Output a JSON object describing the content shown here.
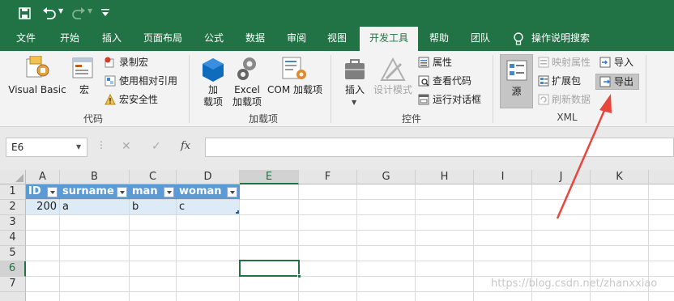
{
  "qat": {
    "save_icon": "save-icon",
    "undo_icon": "undo-icon",
    "redo_icon": "redo-icon",
    "customize_icon": "customize-qat-icon"
  },
  "tabs": [
    {
      "label": "文件"
    },
    {
      "label": "开始"
    },
    {
      "label": "插入"
    },
    {
      "label": "页面布局"
    },
    {
      "label": "公式"
    },
    {
      "label": "数据"
    },
    {
      "label": "审阅"
    },
    {
      "label": "视图"
    },
    {
      "label": "开发工具"
    },
    {
      "label": "帮助"
    },
    {
      "label": "团队"
    },
    {
      "label": "操作说明搜索"
    }
  ],
  "ribbon": {
    "code": {
      "group_label": "代码",
      "visual_basic": "Visual Basic",
      "macros": "宏",
      "record_macro": "录制宏",
      "relative_ref": "使用相对引用",
      "macro_security": "宏安全性"
    },
    "addins": {
      "group_label": "加载项",
      "addins_line1": "加",
      "addins_line2": "载项",
      "excel_addins_line1": "Excel",
      "excel_addins_line2": "加载项",
      "com_addins": "COM 加载项"
    },
    "controls": {
      "group_label": "控件",
      "insert": "插入",
      "design_mode": "设计模式",
      "properties": "属性",
      "view_code": "查看代码",
      "run_dialog": "运行对话框"
    },
    "xml": {
      "group_label": "XML",
      "source": "源",
      "map_properties": "映射属性",
      "expansion_packs": "扩展包",
      "refresh_data": "刷新数据",
      "import": "导入",
      "export": "导出"
    }
  },
  "formula_bar": {
    "name_box": "E6",
    "fx": "fx",
    "formula": ""
  },
  "columns": [
    "A",
    "B",
    "C",
    "D",
    "E",
    "F",
    "G",
    "H",
    "I",
    "J",
    "K"
  ],
  "rows": [
    "1",
    "2",
    "3",
    "4",
    "5",
    "6",
    "7"
  ],
  "table": {
    "headers": [
      "ID",
      "surname",
      "man",
      "woman"
    ],
    "data": [
      "200",
      "a",
      "b",
      "c"
    ]
  },
  "watermark": "https://blog.csdn.net/zhanxxiao",
  "colors": {
    "excel_green": "#217346",
    "table_header": "#5b9bd5",
    "table_row": "#ddebf7",
    "arrow": "#e8453c"
  }
}
